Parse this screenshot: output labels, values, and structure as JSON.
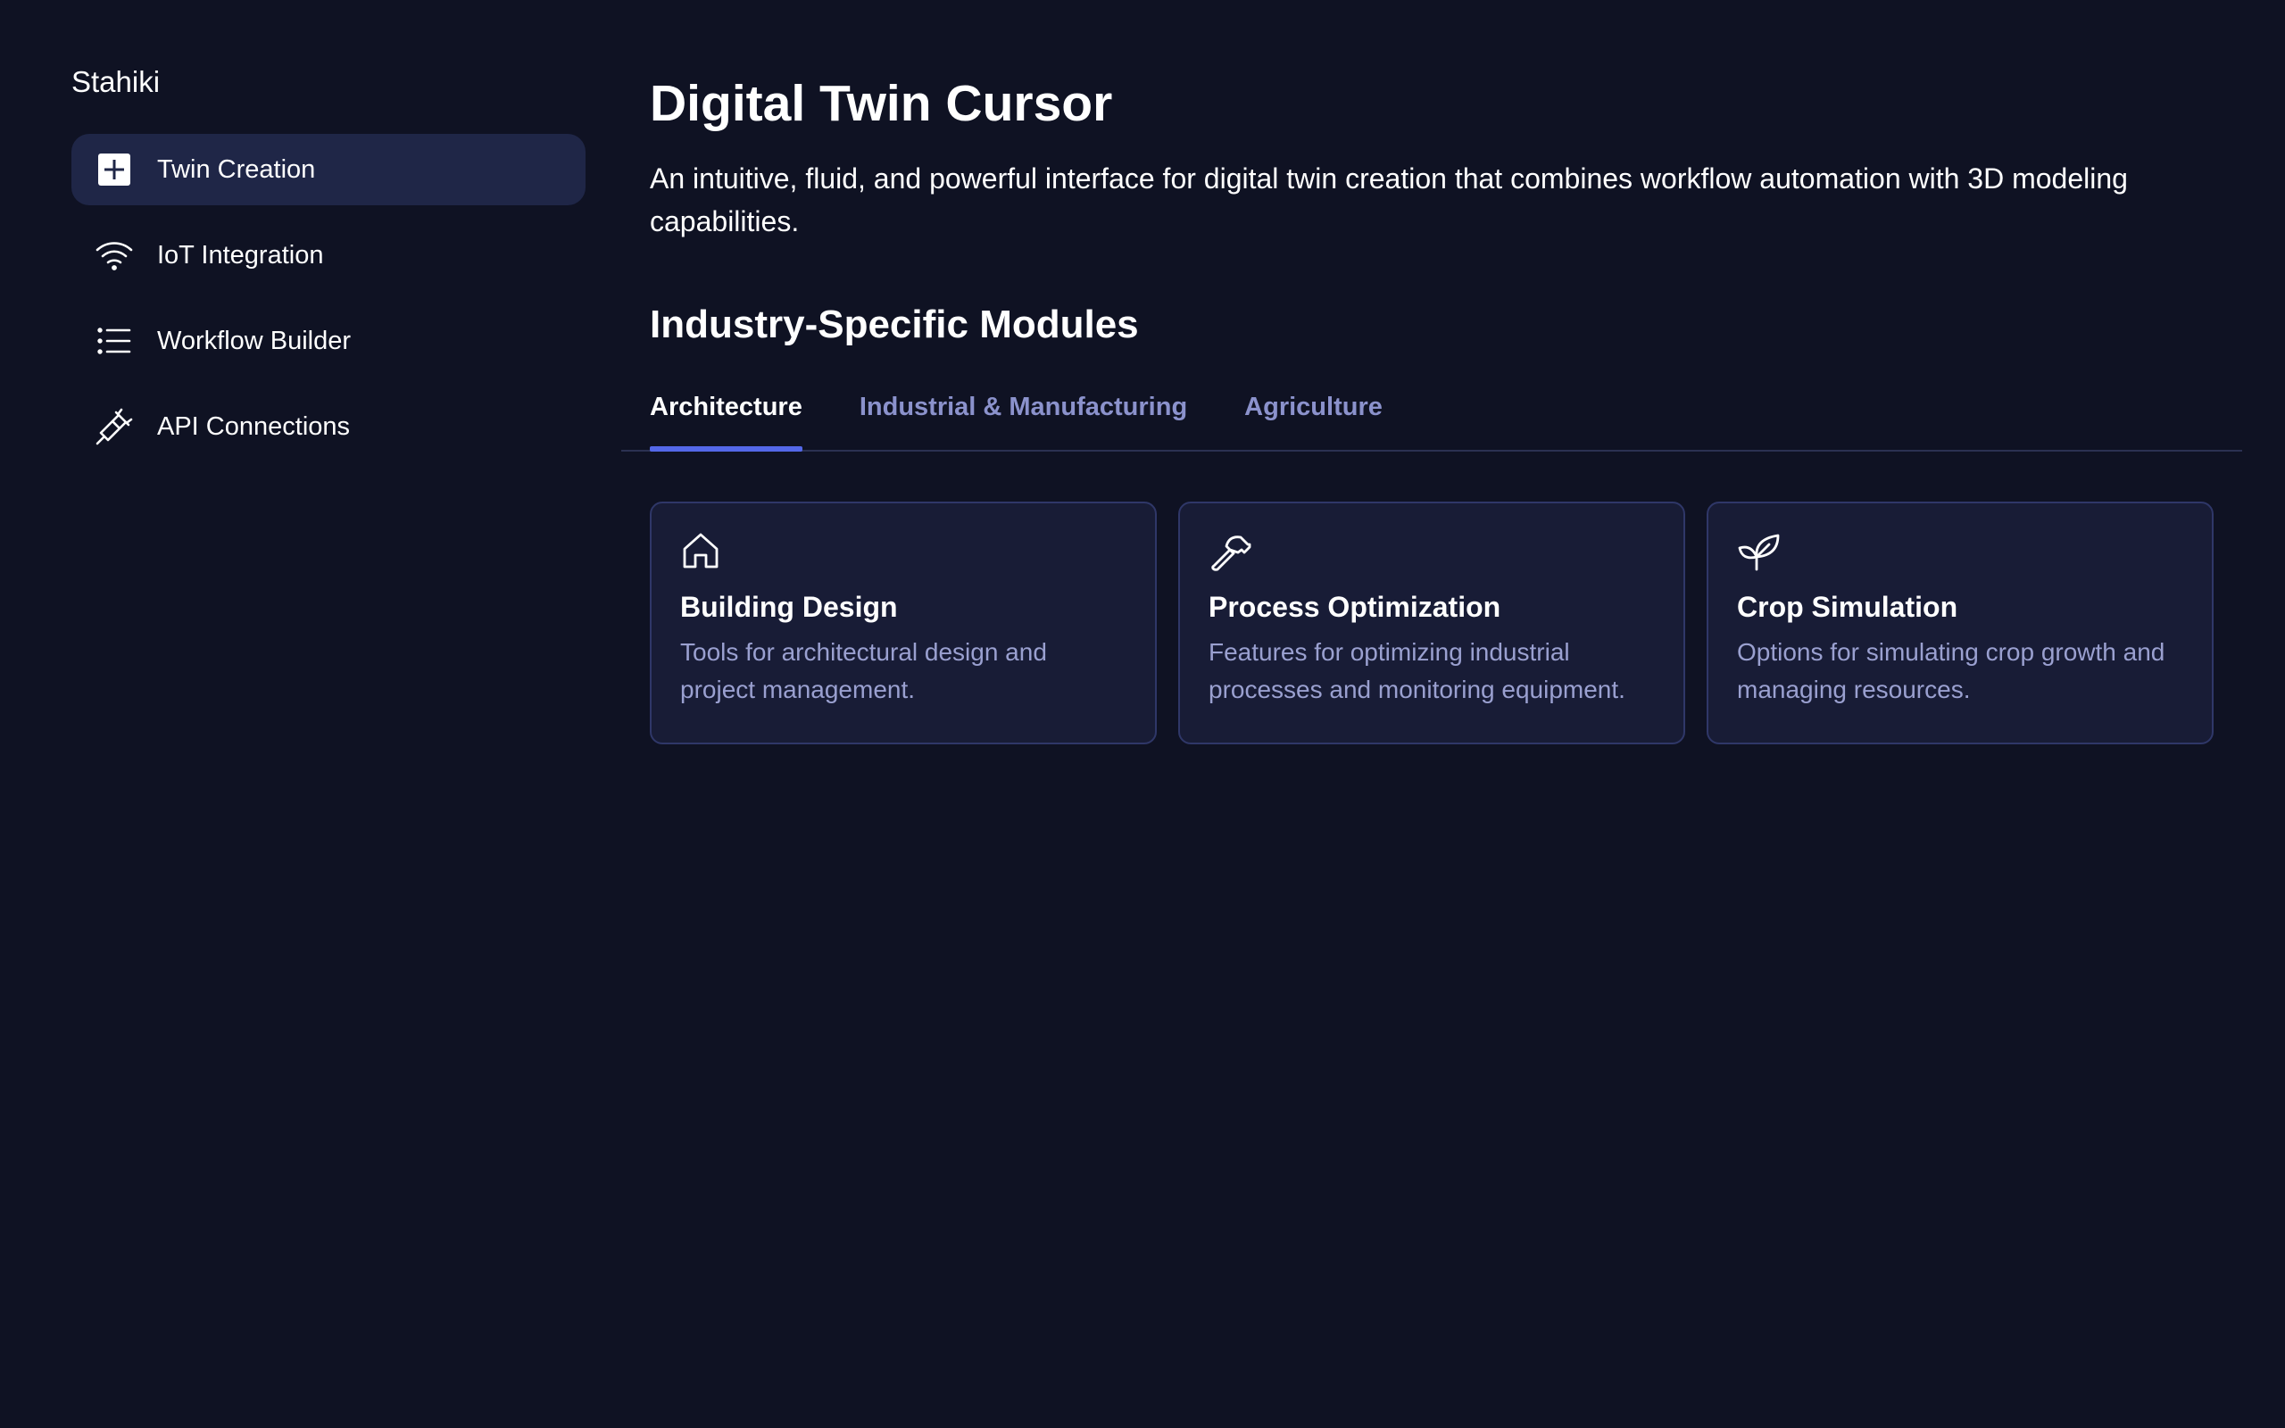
{
  "sidebar": {
    "brand": "Stahiki",
    "items": [
      {
        "label": "Twin Creation",
        "icon": "plus-square-icon",
        "active": true
      },
      {
        "label": "IoT Integration",
        "icon": "wifi-icon",
        "active": false
      },
      {
        "label": "Workflow Builder",
        "icon": "list-icon",
        "active": false
      },
      {
        "label": "API Connections",
        "icon": "plug-icon",
        "active": false
      }
    ]
  },
  "main": {
    "title": "Digital Twin Cursor",
    "description": "An intuitive, fluid, and powerful interface for digital twin creation that combines workflow automation with 3D modeling capabilities.",
    "section_title": "Industry-Specific Modules",
    "tabs": [
      {
        "label": "Architecture",
        "active": true
      },
      {
        "label": "Industrial & Manufacturing",
        "active": false
      },
      {
        "label": "Agriculture",
        "active": false
      }
    ],
    "cards": [
      {
        "icon": "home-icon",
        "title": "Building Design",
        "description": "Tools for architectural design and project management."
      },
      {
        "icon": "hammer-icon",
        "title": "Process Optimization",
        "description": "Features for optimizing industrial processes and monitoring equipment."
      },
      {
        "icon": "sprout-icon",
        "title": "Crop Simulation",
        "description": "Options for simulating crop growth and managing resources."
      }
    ]
  },
  "colors": {
    "background": "#0f1223",
    "sidebar_active": "#1f2647",
    "accent": "#5468e8",
    "card_bg": "#181c36",
    "card_border": "#2f3768",
    "muted_text": "#9aa0d0",
    "tab_inactive": "#8b92cc"
  }
}
